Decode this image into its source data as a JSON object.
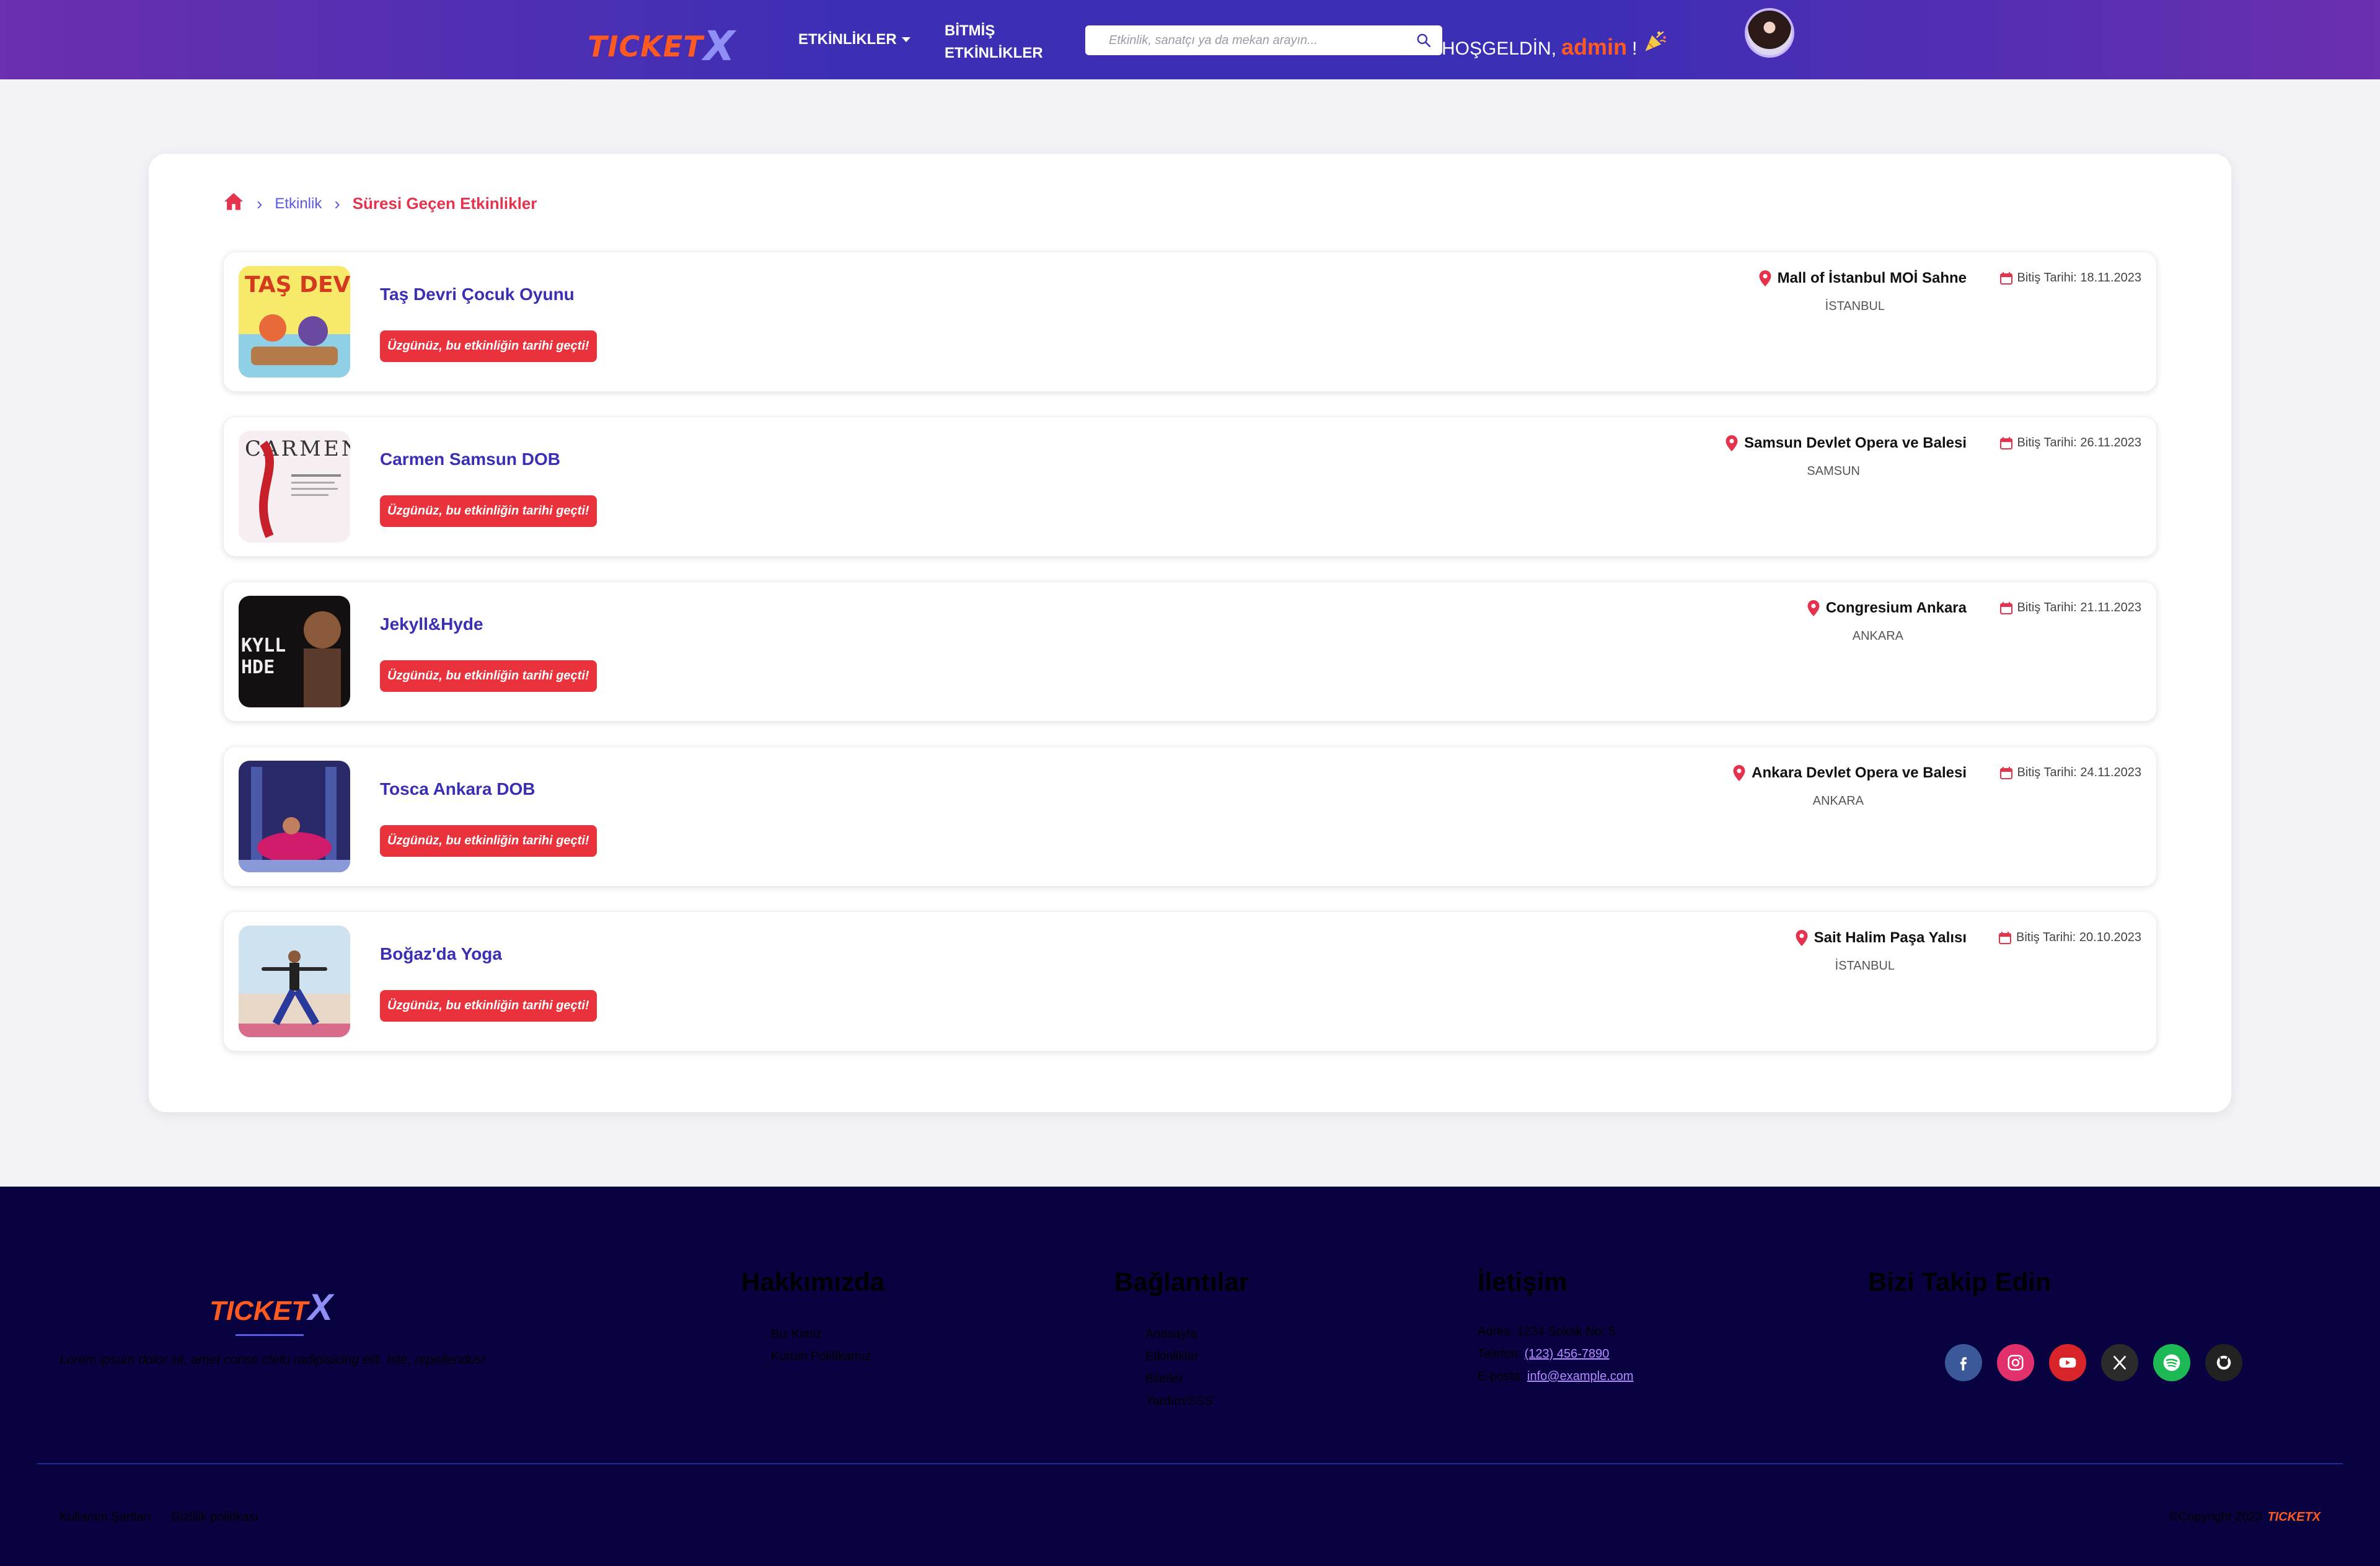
{
  "header": {
    "logo_part1": "TICKET",
    "logo_part2": "X",
    "nav_events": "ETKİNLİKLER",
    "nav_finished_line1": "BİTMİŞ",
    "nav_finished_line2": "ETKİNLİKLER",
    "search_placeholder": "Etkinlik, sanatçı ya da mekan arayın...",
    "welcome_text": "HOŞGELDİN,",
    "username": "admin",
    "welcome_suffix": "!"
  },
  "breadcrumb": {
    "link": "Etkinlik",
    "current": "Süresi Geçen Etkinlikler"
  },
  "events": [
    {
      "title": "Taş Devri Çocuk Oyunu",
      "badge": "Üzgünüz, bu etkinliğin tarihi geçti!",
      "venue": "Mall of İstanbul MOİ Sahne",
      "city": "İSTANBUL",
      "date": "Bitiş Tarihi: 18.11.2023"
    },
    {
      "title": "Carmen Samsun DOB",
      "badge": "Üzgünüz, bu etkinliğin tarihi geçti!",
      "venue": "Samsun Devlet Opera ve Balesi",
      "city": "SAMSUN",
      "date": "Bitiş Tarihi: 26.11.2023"
    },
    {
      "title": "Jekyll&Hyde",
      "badge": "Üzgünüz, bu etkinliğin tarihi geçti!",
      "venue": "Congresium Ankara",
      "city": "ANKARA",
      "date": "Bitiş Tarihi: 21.11.2023"
    },
    {
      "title": "Tosca Ankara DOB",
      "badge": "Üzgünüz, bu etkinliğin tarihi geçti!",
      "venue": "Ankara Devlet Opera ve Balesi",
      "city": "ANKARA",
      "date": "Bitiş Tarihi: 24.11.2023"
    },
    {
      "title": "Boğaz'da Yoga",
      "badge": "Üzgünüz, bu etkinliğin tarihi geçti!",
      "venue": "Sait Halim Paşa Yalısı",
      "city": "İSTANBUL",
      "date": "Bitiş Tarihi: 20.10.2023"
    }
  ],
  "footer": {
    "logo_part1": "TICKET",
    "logo_part2": "X",
    "description": "Lorem ipsum dolor sit, amet conse ctetu radipisicing elit. Iste, repellendus!",
    "about_heading": "Hakkımızda",
    "about_links": [
      "Biz Kimiz",
      "Kurum Politikamız"
    ],
    "links_heading": "Bağlantılar",
    "links": [
      "Anasayfa",
      "Etkinlikler",
      "Biletler",
      "Yardım/SSS"
    ],
    "contact_heading": "İletişim",
    "address": "Adres: 1234 Sokak No: 5",
    "phone_label": "Telefon:",
    "phone": "(123) 456-7890",
    "email_label": "E-posta:",
    "email": "info@example.com",
    "follow_heading": "Bizi Takip Edin",
    "terms": "Kullanım Şartları",
    "privacy": "Gizlilik politikası",
    "copyright": "©Copyright 2023",
    "copyright_brand": "TICKETX"
  },
  "colors": {
    "accent_orange": "#ff5a1f",
    "brand_purple": "#3a2eb5",
    "alert_red": "#e9323c",
    "footer_bg": "#080340"
  },
  "icons": [
    "home-icon",
    "chevron-right-icon",
    "search-icon",
    "location-pin-icon",
    "calendar-icon",
    "party-popper-icon",
    "facebook-icon",
    "instagram-icon",
    "youtube-icon",
    "x-icon",
    "spotify-icon",
    "github-icon"
  ]
}
